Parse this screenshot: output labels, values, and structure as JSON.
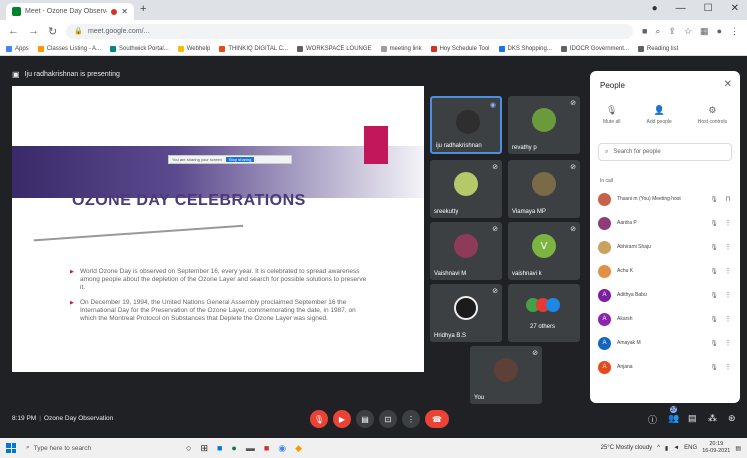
{
  "browser": {
    "tab_title": "Meet - Ozone Day Observat",
    "url": "meet.google.com/...",
    "bookmarks": [
      "Apps",
      "Classes Listing - A...",
      "Southwick Portal...",
      "Webhelp",
      "THINKIQ DIGITAL C...",
      "WORKSPACE LOUNGE",
      "meeting link",
      "Hoy Schedule Tool",
      "DKS Shopping...",
      "IDOCR Government...",
      "Reading list"
    ]
  },
  "meet": {
    "presenting_text": "Iju radhakrishnan is presenting",
    "slide": {
      "title": "OZONE DAY CELEBRATIONS",
      "sharing_bar": "You are sharing your screen",
      "sharing_btn": "Stop sharing",
      "bullets": [
        "World Ozone Day is observed on September 16, every year. It is celebrated to spread awareness among people about the depletion of the Ozone Layer and search for possible solutions to preserve it.",
        "On December 19, 1994, the United Nations General Assembly proclaimed September 16 the International Day for the Preservation of the Ozone Layer, commemorating the date, in 1987, on which the Montreal Protocol on Substances that Deplete the Ozone Layer was signed."
      ]
    },
    "tiles": [
      {
        "name": "iju radhakrishnan"
      },
      {
        "name": "revathy p"
      },
      {
        "name": "sreekutty"
      },
      {
        "name": "Viamaya MP"
      },
      {
        "name": "Vaishnavi M"
      },
      {
        "name": "vaishnavi k"
      },
      {
        "name": "Hridhya B.S"
      },
      {
        "name": "27 others"
      },
      {
        "name": "You"
      }
    ],
    "tile_initial_v": "V",
    "people_panel": {
      "title": "People",
      "actions": [
        {
          "icon": "mute-all-icon",
          "label": "Mute all"
        },
        {
          "icon": "add-people-icon",
          "label": "Add people"
        },
        {
          "icon": "host-controls-icon",
          "label": "Host controls"
        }
      ],
      "search_placeholder": "Search for people",
      "section_label": "In call",
      "participants": [
        {
          "name": "Thasni m (You) Meeting host",
          "initial": "",
          "color": "#c4634a"
        },
        {
          "name": "Aardra P",
          "initial": "",
          "color": "#8e3b7a"
        },
        {
          "name": "Abhirami Shaju",
          "initial": "",
          "color": "#c9a25e"
        },
        {
          "name": "Achu K",
          "initial": "",
          "color": "#e09148"
        },
        {
          "name": "Adithya Babu",
          "initial": "A",
          "color": "#7b1fa2"
        },
        {
          "name": "Akarsh",
          "initial": "A",
          "color": "#8e24aa"
        },
        {
          "name": "Amayak M",
          "initial": "A",
          "color": "#1565c0"
        },
        {
          "name": "Anjana",
          "initial": "A",
          "color": "#e64a19"
        }
      ]
    },
    "bottom": {
      "time": "8:19 PM",
      "meeting_title": "Ozone Day Observation",
      "participant_count_badge": "37"
    }
  },
  "taskbar": {
    "search_placeholder": "Type here to search",
    "weather": "25°C Mostly cloudy",
    "lang": "ENG",
    "time": "20:19",
    "date": "16-09-2021"
  }
}
